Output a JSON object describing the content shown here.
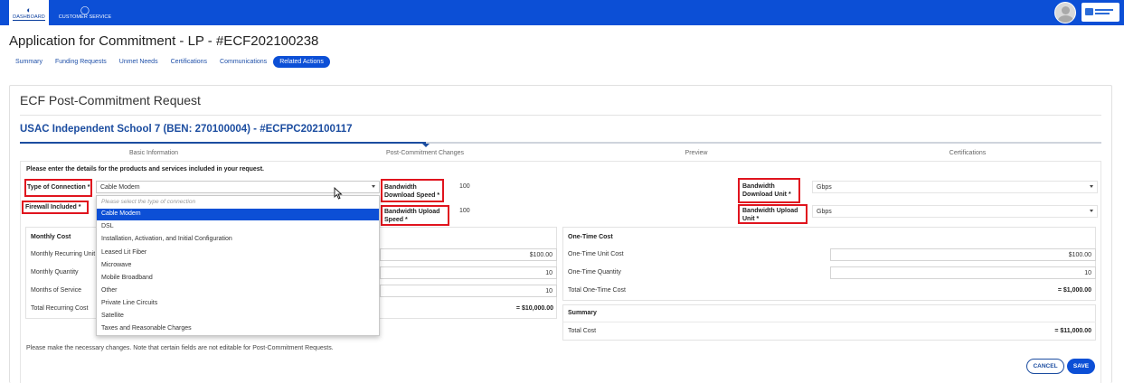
{
  "topnav": {
    "dashboard": "DASHBOARD",
    "customer_service": "CUSTOMER SERVICE"
  },
  "app_title": "Application for Commitment - LP - #ECF202100238",
  "subtabs": [
    "Summary",
    "Funding Requests",
    "Unmet Needs",
    "Certifications",
    "Communications",
    "Related Actions"
  ],
  "active_subtab": "Related Actions",
  "request_title": "ECF Post-Commitment Request",
  "school": "USAC Independent School 7 (BEN: 270100004) - #ECFPC202100117",
  "steps": [
    "Basic Information",
    "Post-Commitment Changes",
    "Preview",
    "Certifications"
  ],
  "instructions": "Please enter the details for the products and services included in your request.",
  "fields": {
    "type_of_connection_label": "Type of Connection *",
    "type_of_connection_value": "Cable Modem",
    "firewall_label": "Firewall Included *",
    "bw_download_speed_label": "Bandwidth Download Speed *",
    "bw_download_speed_value": "100",
    "bw_upload_speed_label": "Bandwidth Upload Speed *",
    "bw_upload_speed_value": "100",
    "bw_download_unit_label": "Bandwidth Download Unit *",
    "bw_download_unit_value": "Gbps",
    "bw_upload_unit_label": "Bandwidth Upload Unit *",
    "bw_upload_unit_value": "Gbps"
  },
  "dropdown": {
    "placeholder": "Please select the type of connection",
    "options": [
      "Cable Modem",
      "DSL",
      "Installation, Activation, and Initial Configuration",
      "Leased Lit Fiber",
      "Microwave",
      "Mobile Broadband",
      "Other",
      "Private Line Circuits",
      "Satellite",
      "Taxes and Reasonable Charges"
    ],
    "selected": "Cable Modem"
  },
  "monthly": {
    "heading": "Monthly Cost",
    "recurring_unit_label": "Monthly Recurring Unit",
    "recurring_unit_value": "$100.00",
    "quantity_label": "Monthly Quantity",
    "quantity_value": "10",
    "months_label": "Months of Service",
    "months_value": "10",
    "total_label": "Total Recurring Cost",
    "total_value": "= $10,000.00"
  },
  "onetime": {
    "heading": "One-Time Cost",
    "unit_cost_label": "One-Time Unit Cost",
    "unit_cost_value": "$100.00",
    "quantity_label": "One-Time Quantity",
    "quantity_value": "10",
    "total_label": "Total One-Time Cost",
    "total_value": "= $1,000.00"
  },
  "summary": {
    "heading": "Summary",
    "total_label": "Total Cost",
    "total_value": "= $11,000.00"
  },
  "note": "Please make the necessary changes. Note that certain fields are not editable for Post-Commitment Requests.",
  "buttons": {
    "cancel": "CANCEL",
    "save": "SAVE"
  },
  "colors": {
    "brand_blue": "#0c4fd6",
    "heading_blue": "#1c4da0",
    "highlight_red": "#e0141e"
  }
}
